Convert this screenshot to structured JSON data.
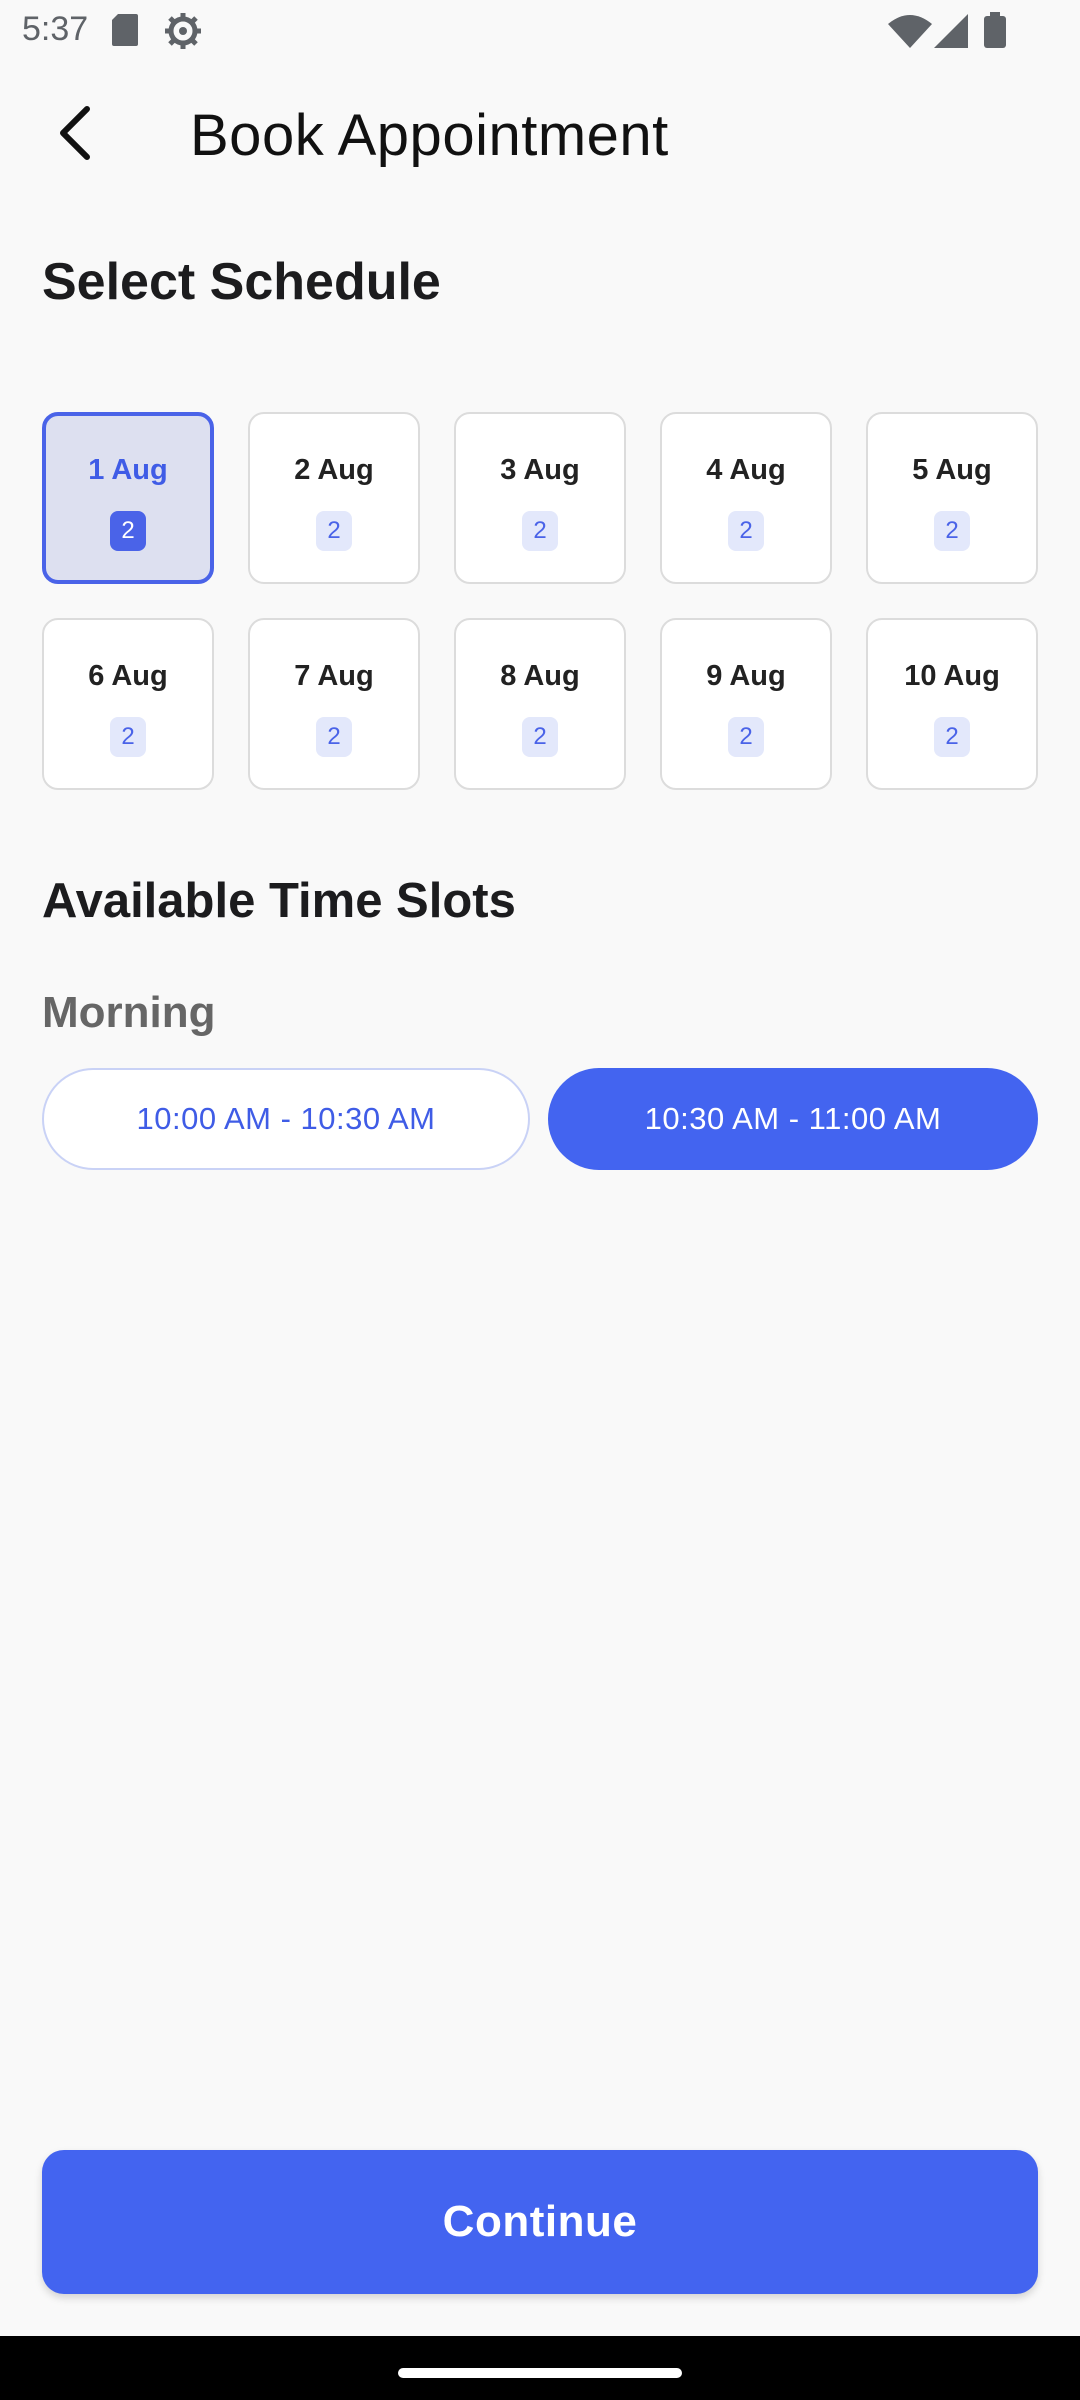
{
  "status_bar": {
    "time": "5:37",
    "icons": [
      "sd-card-icon",
      "gear-icon",
      "wifi-icon",
      "signal-icon",
      "battery-icon"
    ]
  },
  "header": {
    "title": "Book Appointment",
    "back_icon": "chevron-left-icon"
  },
  "schedule": {
    "title": "Select Schedule",
    "selected_index": 0,
    "dates": [
      {
        "label": "1 Aug",
        "count": "2"
      },
      {
        "label": "2 Aug",
        "count": "2"
      },
      {
        "label": "3 Aug",
        "count": "2"
      },
      {
        "label": "4 Aug",
        "count": "2"
      },
      {
        "label": "5 Aug",
        "count": "2"
      },
      {
        "label": "6 Aug",
        "count": "2"
      },
      {
        "label": "7 Aug",
        "count": "2"
      },
      {
        "label": "8 Aug",
        "count": "2"
      },
      {
        "label": "9 Aug",
        "count": "2"
      },
      {
        "label": "10 Aug",
        "count": "2"
      }
    ]
  },
  "time_slots": {
    "title": "Available Time Slots",
    "morning_label": "Morning",
    "slots": [
      {
        "label": "10:00 AM - 10:30 AM",
        "selected": false
      },
      {
        "label": "10:30 AM - 11:00 AM",
        "selected": true
      }
    ]
  },
  "footer": {
    "continue_label": "Continue"
  },
  "colors": {
    "accent": "#4364f0",
    "selected_card_bg": "#dde0f0",
    "count_badge_bg": "#e3e8fb",
    "background": "#f9f9f9"
  }
}
